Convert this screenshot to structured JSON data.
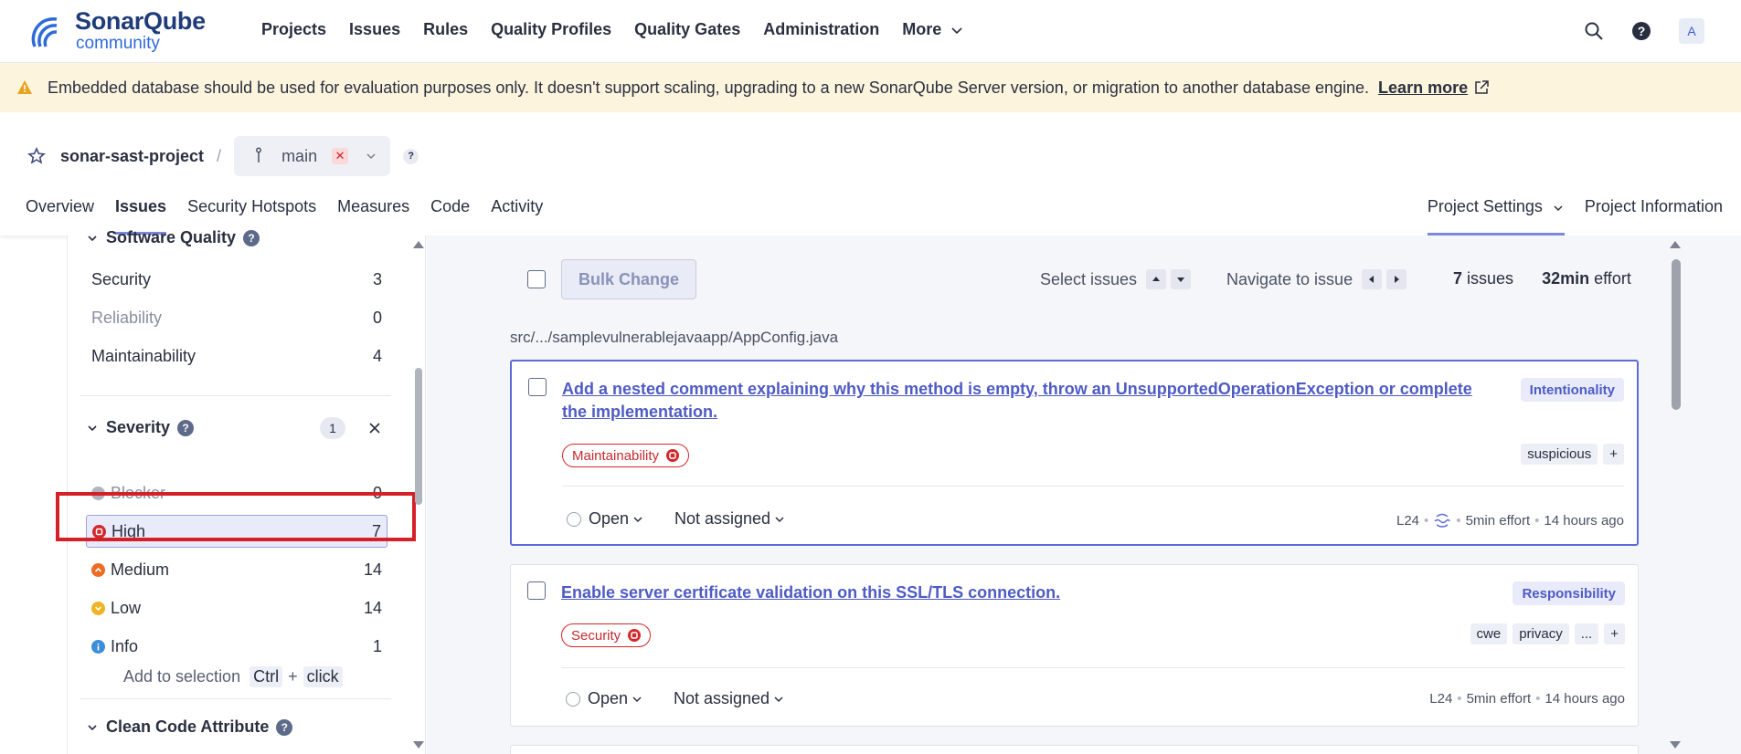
{
  "nav": {
    "logo_main": "SonarQube",
    "logo_sub": "community",
    "links": [
      "Projects",
      "Issues",
      "Rules",
      "Quality Profiles",
      "Quality Gates",
      "Administration"
    ],
    "more_label": "More",
    "avatar_letter": "A"
  },
  "banner": {
    "text": "Embedded database should be used for evaluation purposes only. It doesn't support scaling, upgrading to a new SonarQube Server version, or migration to another database engine.",
    "link": "Learn more"
  },
  "project": {
    "name": "sonar-sast-project",
    "branch": "main",
    "tabs": [
      "Overview",
      "Issues",
      "Security Hotspots",
      "Measures",
      "Code",
      "Activity"
    ],
    "active_tab": "Issues",
    "settings_label": "Project Settings",
    "info_label": "Project Information"
  },
  "sidebar": {
    "software_quality": {
      "title": "Software Quality",
      "items": [
        {
          "label": "Security",
          "count": "3"
        },
        {
          "label": "Reliability",
          "count": "0"
        },
        {
          "label": "Maintainability",
          "count": "4"
        }
      ]
    },
    "severity": {
      "title": "Severity",
      "badge": "1",
      "items": [
        {
          "label": "Blocker",
          "count": "0",
          "color": "#b0b4bf"
        },
        {
          "label": "High",
          "count": "7",
          "color": "#d4272b"
        },
        {
          "label": "Medium",
          "count": "14",
          "color": "#ee6b22"
        },
        {
          "label": "Low",
          "count": "14",
          "color": "#f0b423"
        },
        {
          "label": "Info",
          "count": "1",
          "color": "#3d8ed8"
        }
      ],
      "add_to_selection": "Add to selection",
      "key1": "Ctrl",
      "plus": "+",
      "key2": "click"
    },
    "clean_code": {
      "title": "Clean Code Attribute"
    }
  },
  "toolbar": {
    "bulk_change": "Bulk Change",
    "select_issues": "Select issues",
    "navigate": "Navigate to issue",
    "issue_count": "7",
    "issues_word": "issues",
    "effort": "32min",
    "effort_word": "effort"
  },
  "file_path": "src/.../samplevulnerablejavaapp/AppConfig.java",
  "issues": [
    {
      "title": "Add a nested comment explaining why this method is empty, throw an UnsupportedOperationException or complete the implementation.",
      "attribute": "Intentionality",
      "quality": "Maintainability",
      "tags": [
        "suspicious",
        "+"
      ],
      "status": "Open",
      "assignee": "Not assigned",
      "line": "L24",
      "effort": "5min effort",
      "age": "14 hours ago"
    },
    {
      "title": "Enable server certificate validation on this SSL/TLS connection.",
      "attribute": "Responsibility",
      "quality": "Security",
      "tags": [
        "cwe",
        "privacy",
        "...",
        "+"
      ],
      "status": "Open",
      "assignee": "Not assigned",
      "line": "L24",
      "effort": "5min effort",
      "age": "14 hours ago"
    }
  ]
}
